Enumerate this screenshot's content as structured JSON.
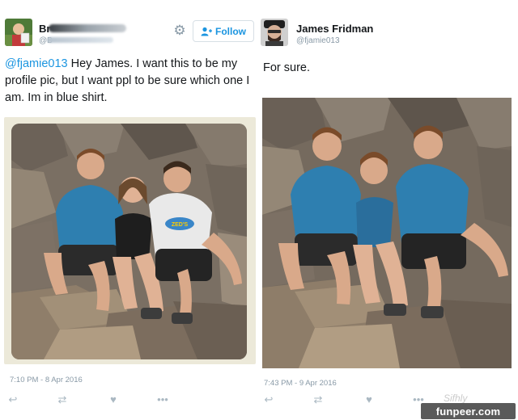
{
  "left_tweet": {
    "display_name_prefix": "Br",
    "handle_prefix": "@B",
    "follow_label": "Follow",
    "mention": "@fjamie013",
    "text": " Hey James. I want this to be my profile pic, but I want ppl to be sure which one I am. Im in blue shirt.",
    "timestamp": "7:10 PM - 8 Apr 2016",
    "shirt_text": "ZED'S"
  },
  "right_tweet": {
    "display_name": "James Fridman",
    "handle": "@fjamie013",
    "text": "For sure.",
    "timestamp": "7:43 PM - 9 Apr 2016"
  },
  "icons": {
    "gear": "gear-icon",
    "follow": "add-user-icon",
    "reply": "reply-icon",
    "retweet": "retweet-icon",
    "like": "heart-icon",
    "more": "more-icon"
  },
  "watermark": {
    "faint": "Sifhly",
    "label": "funpeer.com"
  },
  "colors": {
    "link": "#1b95e0",
    "muted": "#8899a6",
    "shirt_blue": "#2e7fb0",
    "rock": "#8a7a6a"
  }
}
